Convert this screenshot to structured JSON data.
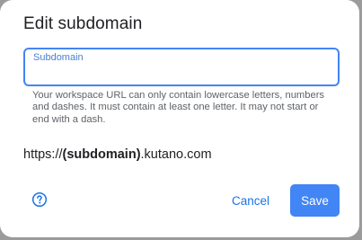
{
  "dialog": {
    "title": "Edit subdomain",
    "field": {
      "label": "Subdomain",
      "value": "",
      "placeholder": ""
    },
    "help_text": "Your workspace URL can only contain lowercase letters, numbers and dashes. It must contain at least one letter. It may not start or end with a dash.",
    "url": {
      "prefix": "https://",
      "subdomain": "(subdomain)",
      "suffix": ".kutano.com"
    },
    "help_icon": "question-circle-icon",
    "cancel_label": "Cancel",
    "save_label": "Save"
  },
  "colors": {
    "accent": "#4285f4",
    "link": "#1a73e8",
    "backdrop": "#9b9b9b"
  }
}
